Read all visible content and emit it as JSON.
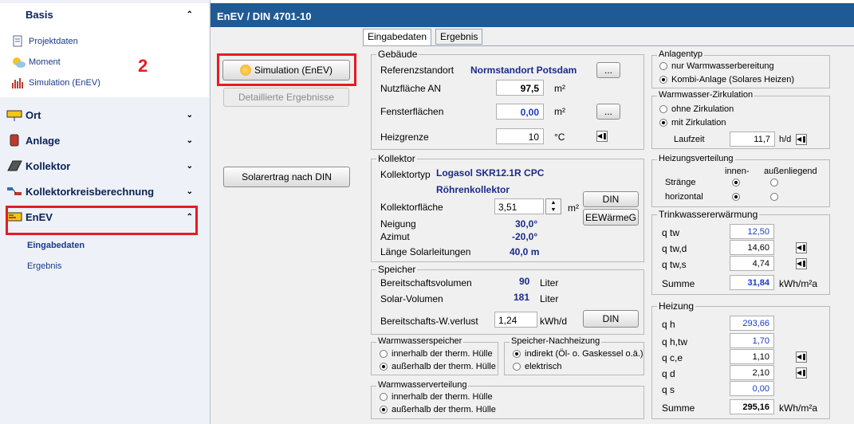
{
  "sidebar": {
    "basis_label": "Basis",
    "sub_items": [
      "Projektdaten",
      "Moment",
      "Simulation (EnEV)"
    ],
    "annotation_number": "2",
    "sections": [
      "Ort",
      "Anlage",
      "Kollektor",
      "Kollektorkreisberechnung",
      "EnEV"
    ],
    "enev_items": [
      "Eingabedaten",
      "Ergebnis"
    ]
  },
  "header": {
    "title": "EnEV / DIN 4701-10"
  },
  "tabs": [
    "Eingabedaten",
    "Ergebnis"
  ],
  "buttons": {
    "simulation": "Simulation (EnEV)",
    "detail": "Detaillierte Ergebnisse",
    "solarertrag": "Solarertrag nach DIN",
    "ellipsis": "...",
    "din": "DIN",
    "eewaermeg": "EEWärmeG"
  },
  "gebaeude": {
    "title": "Gebäude",
    "referenz_label": "Referenzstandort",
    "referenz_value": "Normstandort Potsdam",
    "nutzflaeche_label": "Nutzfläche AN",
    "nutzflaeche_value": "97,5",
    "nutzflaeche_unit": "m²",
    "fenster_label": "Fensterflächen",
    "fenster_value": "0,00",
    "fenster_unit": "m²",
    "heizgrenze_label": "Heizgrenze",
    "heizgrenze_value": "10",
    "heizgrenze_unit": "°C"
  },
  "kollektor": {
    "title": "Kollektor",
    "typ_label": "Kollektortyp",
    "typ_value": "Logasol SKR12.1R CPC",
    "typ_value2": "Röhrenkollektor",
    "flaeche_label": "Kollektorfläche",
    "flaeche_value": "3,51",
    "flaeche_unit": "m²",
    "neigung_label": "Neigung",
    "neigung_value": "30,0°",
    "azimut_label": "Azimut",
    "azimut_value": "-20,0°",
    "laenge_label": "Länge Solarleitungen",
    "laenge_value": "40,0 m"
  },
  "speicher": {
    "title": "Speicher",
    "bereitschaft_label": "Bereitschaftsvolumen",
    "bereitschaft_value": "90",
    "bereitschaft_unit": "Liter",
    "solar_label": "Solar-Volumen",
    "solar_value": "181",
    "solar_unit": "Liter",
    "verlust_label": "Bereitschafts-W.verlust",
    "verlust_value": "1,24",
    "verlust_unit": "kWh/d"
  },
  "warmwasserspeicher": {
    "title": "Warmwasserspeicher",
    "options": [
      "innerhalb der therm. Hülle",
      "außerhalb der therm. Hülle"
    ],
    "selected": 1
  },
  "nachheizung": {
    "title": "Speicher-Nachheizung",
    "options": [
      "indirekt (Öl- o. Gaskessel o.ä.)",
      "elektrisch"
    ],
    "selected": 0
  },
  "warmwasserverteilung": {
    "title": "Warmwasserverteilung",
    "options": [
      "innerhalb der therm. Hülle",
      "außerhalb der therm. Hülle"
    ],
    "selected": 1
  },
  "anlagentyp": {
    "title": "Anlagentyp",
    "options": [
      "nur Warmwasserbereitung",
      "Kombi-Anlage (Solares Heizen)"
    ],
    "selected": 1
  },
  "zirkulation": {
    "title": "Warmwasser-Zirkulation",
    "options": [
      "ohne Zirkulation",
      "mit Zirkulation"
    ],
    "selected": 1,
    "laufzeit_label": "Laufzeit",
    "laufzeit_value": "11,7",
    "laufzeit_unit": "h/d"
  },
  "heizungsverteilung": {
    "title": "Heizungsverteilung",
    "col_innen": "innen-",
    "col_aussen": "außenliegend",
    "row_straenge": "Stränge",
    "row_horizontal": "horizontal"
  },
  "trinkwasser": {
    "title": "Trinkwassererwärmung",
    "rows": [
      {
        "label": "q tw",
        "value": "12,50"
      },
      {
        "label": "q tw,d",
        "value": "14,60"
      },
      {
        "label": "q tw,s",
        "value": "4,74"
      }
    ],
    "summe_label": "Summe",
    "summe_value": "31,84",
    "summe_unit": "kWh/m²a"
  },
  "heizung": {
    "title": "Heizung",
    "rows": [
      {
        "label": "q h",
        "value": "293,66"
      },
      {
        "label": "q h,tw",
        "value": "1,70"
      },
      {
        "label": "q c,e",
        "value": "1,10"
      },
      {
        "label": "q d",
        "value": "2,10"
      },
      {
        "label": "q s",
        "value": "0,00"
      }
    ],
    "summe_label": "Summe",
    "summe_value": "295,16",
    "summe_unit": "kWh/m²a"
  },
  "colors": {
    "header": "#1f5a95",
    "accent_blue": "#1a2a8c",
    "annotation_red": "#e51c23"
  }
}
